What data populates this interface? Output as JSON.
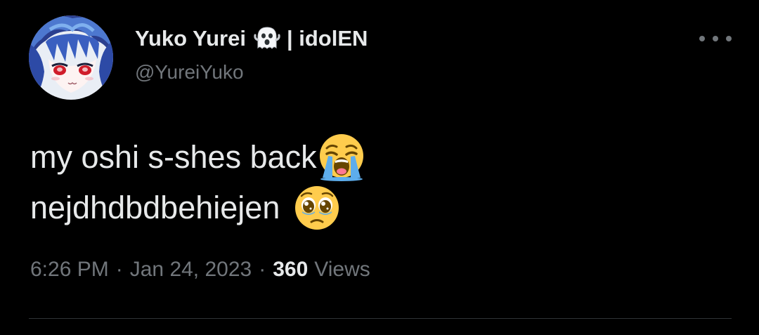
{
  "author": {
    "display_name": "Yuko Yurei",
    "name_emoji": "ghost-emoji",
    "affiliation": "| idolEN",
    "handle": "@YureiYuko",
    "avatar_icon": "avatar-anime-girl"
  },
  "tweet": {
    "line1": "my oshi s-shes back",
    "line1_emoji": "loudly-crying-face-emoji",
    "line2": "nejdhdbdbehiejen",
    "line2_emoji": "pleading-face-emoji"
  },
  "meta": {
    "time": "6:26 PM",
    "separator": "·",
    "date": "Jan 24, 2023",
    "views_count": "360",
    "views_label": "Views"
  },
  "actions": {
    "more_icon": "more-horizontal-icon"
  },
  "colors": {
    "background": "#000000",
    "primary_text": "#e7e9ea",
    "secondary_text": "#71767b",
    "divider": "#2f3336"
  }
}
